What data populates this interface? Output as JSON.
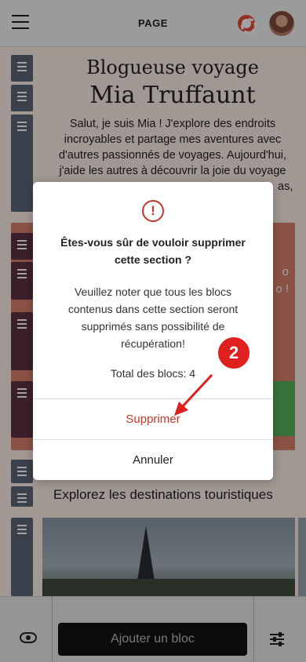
{
  "header": {
    "title": "PAGE"
  },
  "hero": {
    "line1": "Blogueuse voyage",
    "line2": "Mia Truffaunt",
    "intro": "Salut, je suis Mia ! J'explore des endroits incroyables et partage mes aventures avec d'autres passionnés de voyages. Aujourd'hui, j'aide les autres à découvrir la joie du voyage",
    "intro_tail": "as,"
  },
  "section2": {
    "frag1": "o",
    "frag2": "o !"
  },
  "explore": {
    "subtitle": "Explorez les destinations touristiques"
  },
  "modal": {
    "question": "Êtes-vous sûr de vouloir supprimer cette section ?",
    "note": "Veuillez noter que tous les blocs contenus dans cette section seront supprimés sans possibilité de récupération!",
    "count": "Total des blocs: 4",
    "delete_label": "Supprimer",
    "cancel_label": "Annuler",
    "icon": "alert-circle-icon"
  },
  "annotation": {
    "step": "2"
  },
  "bottombar": {
    "add_block_label": "Ajouter un bloc"
  },
  "colors": {
    "accent": "#c0392b",
    "badge": "#e01f1f",
    "hero_bg": "#fdeee6",
    "section_bg": "#d8806c",
    "green": "#58b35a"
  }
}
